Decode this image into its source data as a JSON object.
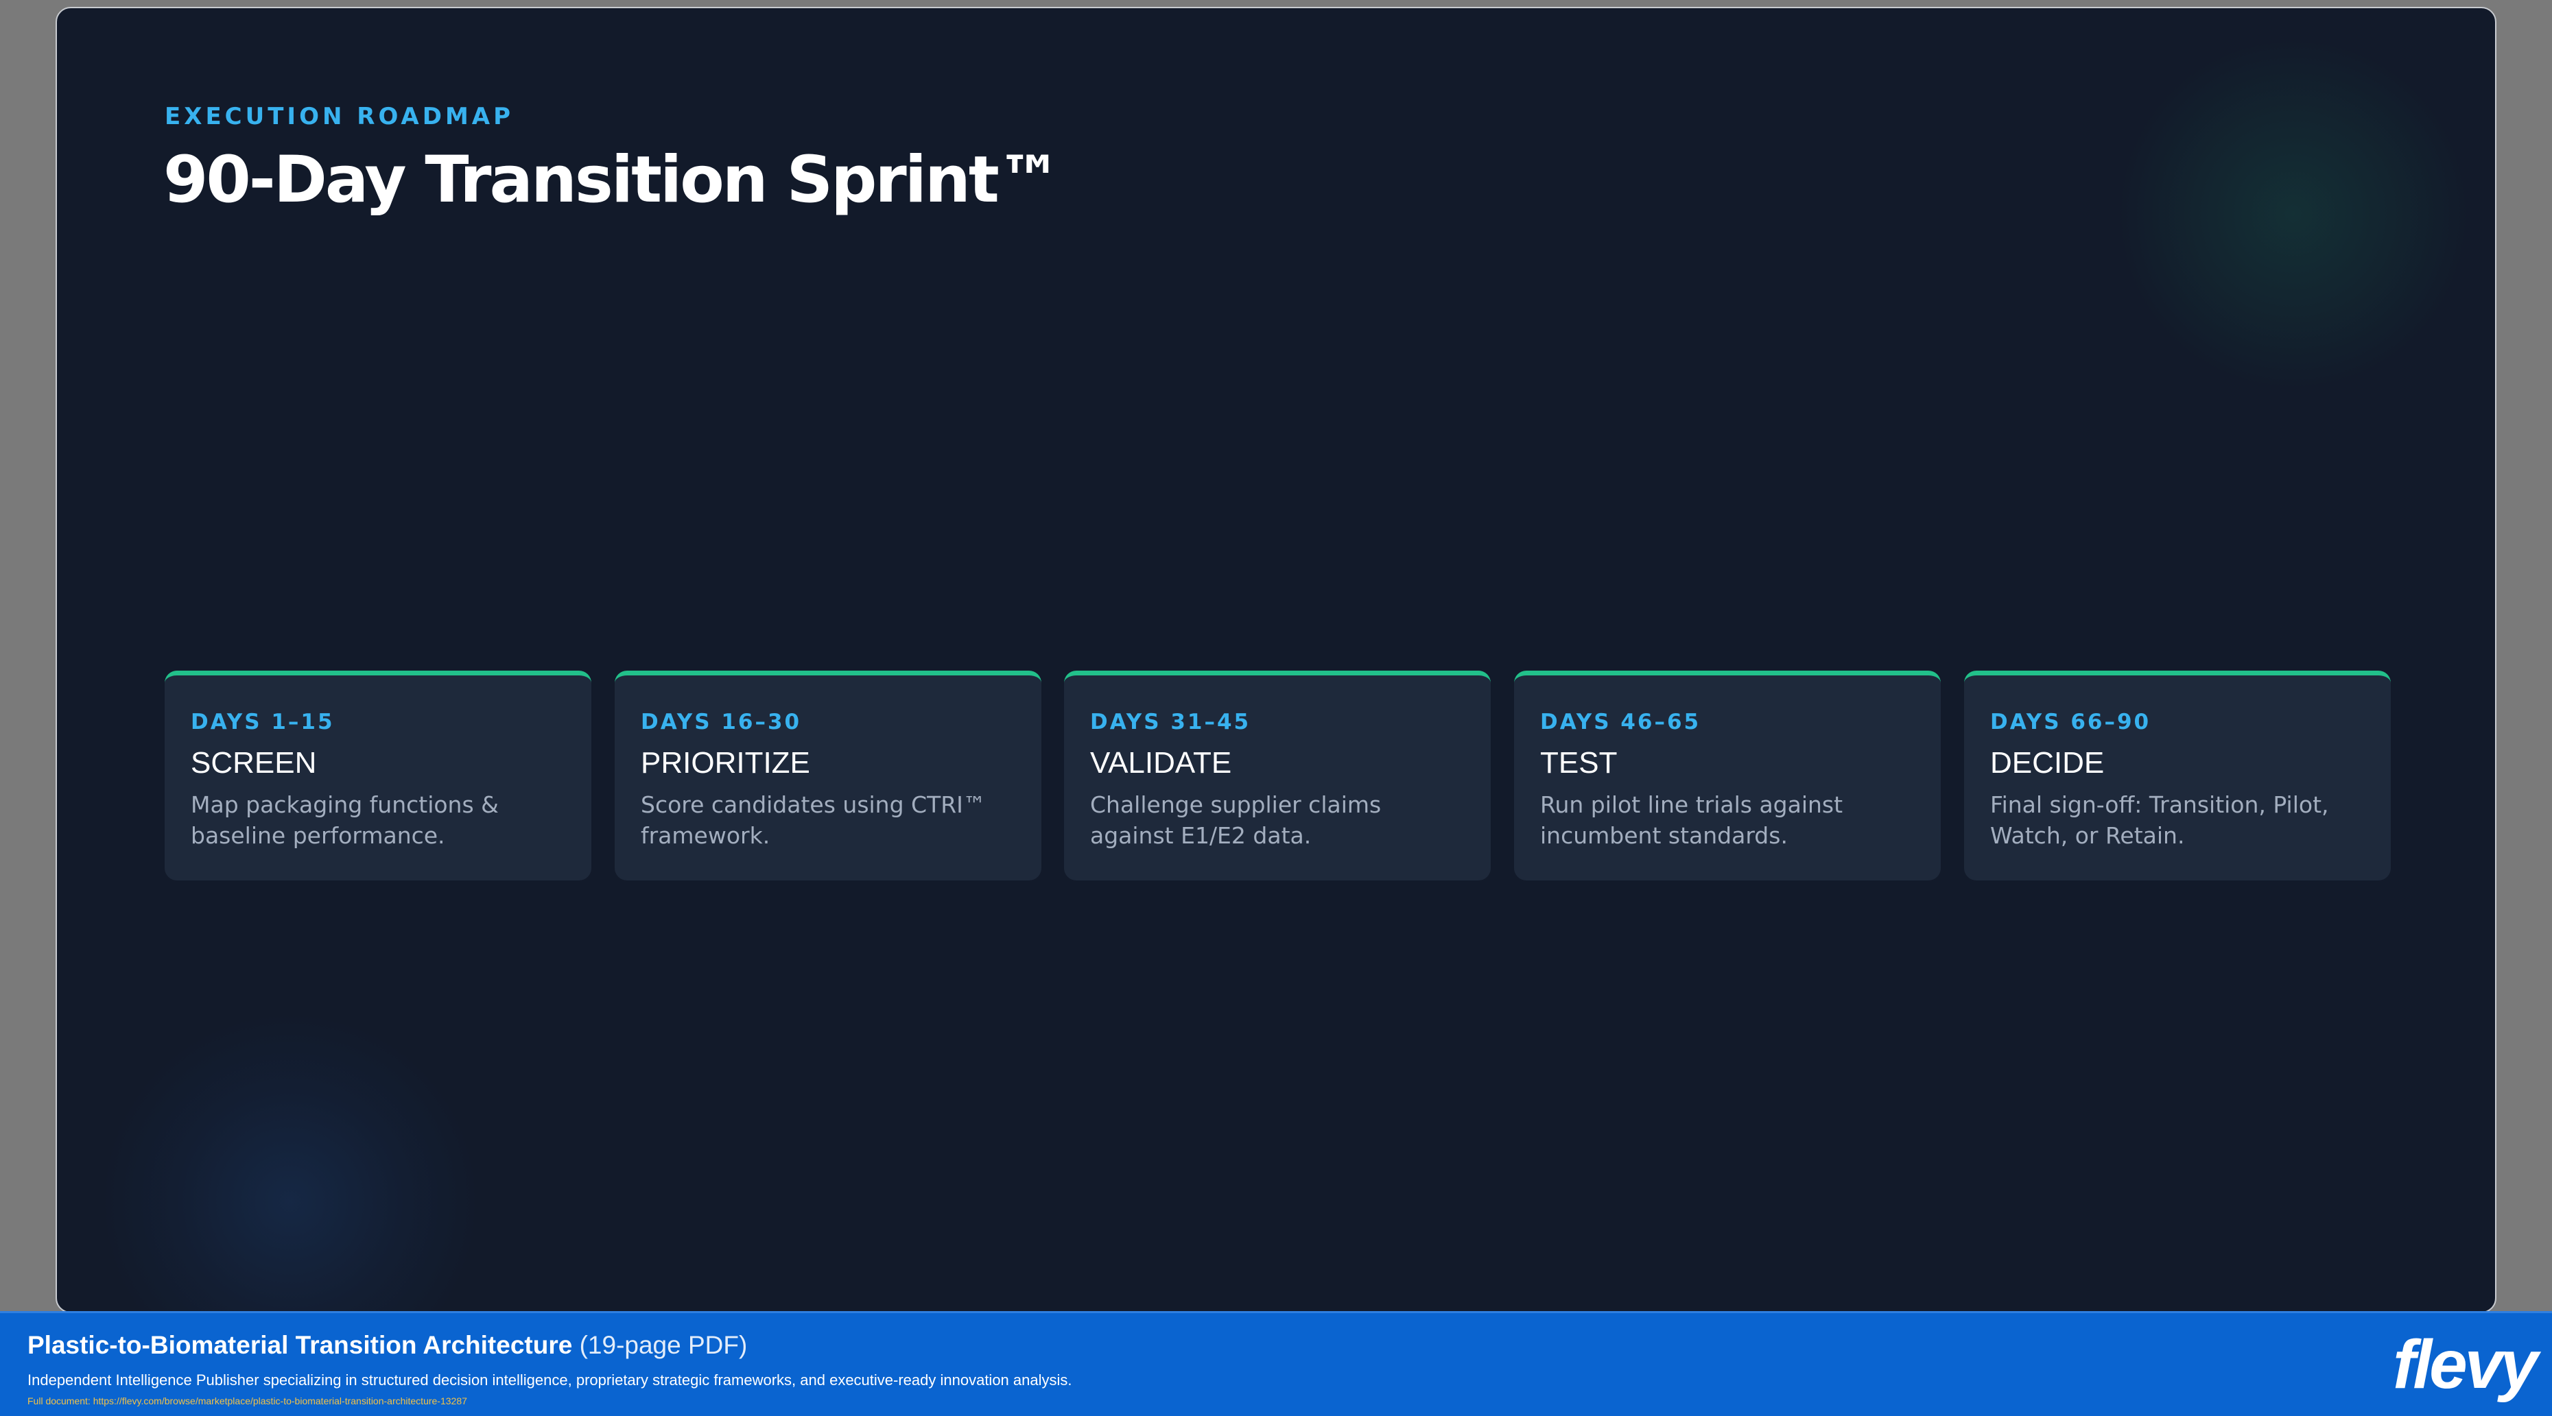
{
  "slide": {
    "eyebrow": "EXECUTION ROADMAP",
    "title": "90-Day Transition Sprint™",
    "phases": [
      {
        "days": "DAYS 1–15",
        "name": "SCREEN",
        "description": "Map packaging functions & baseline performance."
      },
      {
        "days": "DAYS 16–30",
        "name": "PRIORITIZE",
        "description": "Score candidates using CTRI™ framework."
      },
      {
        "days": "DAYS 31–45",
        "name": "VALIDATE",
        "description": "Challenge supplier claims against E1/E2 data."
      },
      {
        "days": "DAYS 46–65",
        "name": "TEST",
        "description": "Run pilot line trials against incumbent standards."
      },
      {
        "days": "DAYS 66–90",
        "name": "DECIDE",
        "description": "Final sign-off: Transition, Pilot, Watch, or Retain."
      }
    ]
  },
  "banner": {
    "doc_title": "Plastic-to-Biomaterial Transition Architecture",
    "doc_pages": "(19-page PDF)",
    "description": "Independent Intelligence Publisher specializing in structured decision intelligence, proprietary strategic frameworks, and executive-ready innovation analysis.",
    "link": "Full document: https://flevy.com/browse/marketplace/plastic-to-biomaterial-transition-architecture-13287",
    "logo": "flevy"
  },
  "colors": {
    "slide_background": "#121a2a",
    "card_background": "#1e293b",
    "accent_blue": "#38b2ef",
    "accent_green": "#22c08a",
    "banner_blue": "#0a64d0"
  }
}
